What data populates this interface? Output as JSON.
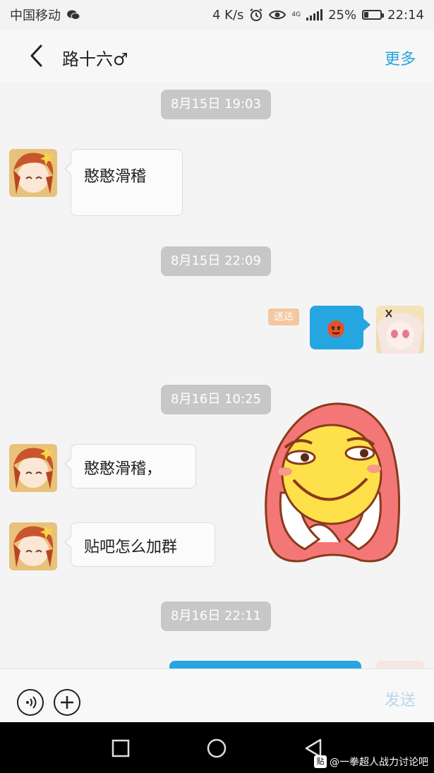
{
  "status_bar": {
    "carrier": "中国移动",
    "speed": "4 K/s",
    "network": "4G",
    "battery": "25%",
    "battery_level": 0.25,
    "time": "22:14"
  },
  "header": {
    "title": "路十六♂",
    "more_label": "更多"
  },
  "messages": {
    "t1": "8月15日 19:03",
    "m1": "憨憨滑稽",
    "t2": "8月15日 22:09",
    "sent_status": "送达",
    "t3": "8月16日 10:25",
    "m2": "憨憨滑稽，",
    "m3": "贴吧怎么加群",
    "t4": "8月16日 22:11"
  },
  "input": {
    "send_label": "发送"
  },
  "watermark": {
    "badge": "贴",
    "text": "@一拳超人战力讨论吧"
  },
  "colors": {
    "accent": "#24a5d8",
    "bubble_sent": "#26a6e0",
    "time_chip": "#c7c7c7"
  }
}
